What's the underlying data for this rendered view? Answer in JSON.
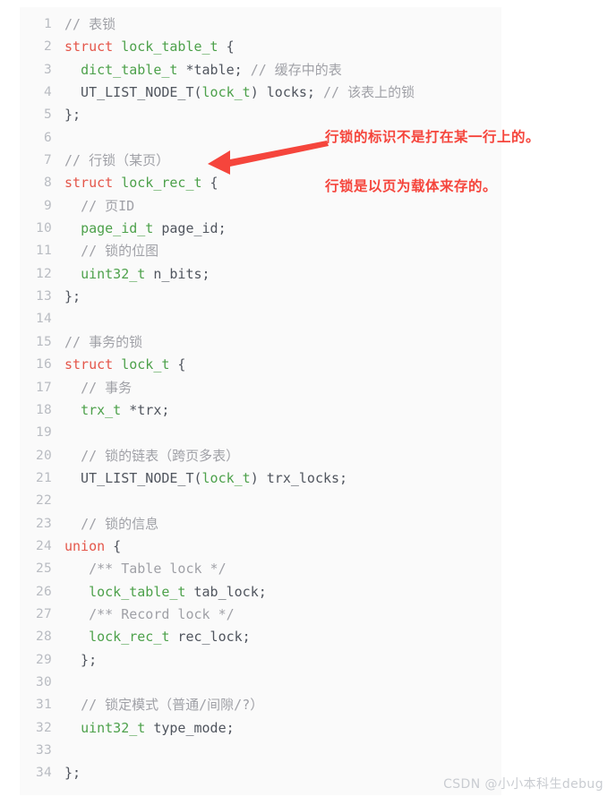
{
  "code_block": {
    "language_style": "c-like",
    "background_color": "#fafafa",
    "gutter_color": "#b9bcc2",
    "token_colors": {
      "comment": "#a0a1a7",
      "keyword": "#e4564a",
      "type": "#4da14b",
      "plain": "#50555e"
    },
    "lines": [
      {
        "n": "1",
        "tokens": [
          {
            "c": "com",
            "t": "// 表锁"
          }
        ]
      },
      {
        "n": "2",
        "tokens": [
          {
            "c": "kw",
            "t": "struct"
          },
          {
            "c": "pln",
            "t": " "
          },
          {
            "c": "typ",
            "t": "lock_table_t"
          },
          {
            "c": "pln",
            "t": " {"
          }
        ]
      },
      {
        "n": "3",
        "tokens": [
          {
            "c": "pln",
            "t": "  "
          },
          {
            "c": "typ",
            "t": "dict_table_t"
          },
          {
            "c": "pln",
            "t": " *table; "
          },
          {
            "c": "com",
            "t": "// 缓存中的表"
          }
        ]
      },
      {
        "n": "4",
        "tokens": [
          {
            "c": "pln",
            "t": "  UT_LIST_NODE_T("
          },
          {
            "c": "typ",
            "t": "lock_t"
          },
          {
            "c": "pln",
            "t": ") locks; "
          },
          {
            "c": "com",
            "t": "// 该表上的锁"
          }
        ]
      },
      {
        "n": "5",
        "tokens": [
          {
            "c": "pln",
            "t": "};"
          }
        ]
      },
      {
        "n": "6",
        "tokens": []
      },
      {
        "n": "7",
        "tokens": [
          {
            "c": "com",
            "t": "// 行锁（某页）"
          }
        ]
      },
      {
        "n": "8",
        "tokens": [
          {
            "c": "kw",
            "t": "struct"
          },
          {
            "c": "pln",
            "t": " "
          },
          {
            "c": "typ",
            "t": "lock_rec_t"
          },
          {
            "c": "pln",
            "t": " {"
          }
        ]
      },
      {
        "n": "9",
        "tokens": [
          {
            "c": "pln",
            "t": "  "
          },
          {
            "c": "com",
            "t": "// 页ID"
          }
        ]
      },
      {
        "n": "10",
        "tokens": [
          {
            "c": "pln",
            "t": "  "
          },
          {
            "c": "typ",
            "t": "page_id_t"
          },
          {
            "c": "pln",
            "t": " page_id;"
          }
        ]
      },
      {
        "n": "11",
        "tokens": [
          {
            "c": "pln",
            "t": "  "
          },
          {
            "c": "com",
            "t": "// 锁的位图"
          }
        ]
      },
      {
        "n": "12",
        "tokens": [
          {
            "c": "pln",
            "t": "  "
          },
          {
            "c": "typ",
            "t": "uint32_t"
          },
          {
            "c": "pln",
            "t": " n_bits;"
          }
        ]
      },
      {
        "n": "13",
        "tokens": [
          {
            "c": "pln",
            "t": "};"
          }
        ]
      },
      {
        "n": "14",
        "tokens": []
      },
      {
        "n": "15",
        "tokens": [
          {
            "c": "com",
            "t": "// 事务的锁"
          }
        ]
      },
      {
        "n": "16",
        "tokens": [
          {
            "c": "kw",
            "t": "struct"
          },
          {
            "c": "pln",
            "t": " "
          },
          {
            "c": "typ",
            "t": "lock_t"
          },
          {
            "c": "pln",
            "t": " {"
          }
        ]
      },
      {
        "n": "17",
        "tokens": [
          {
            "c": "pln",
            "t": "  "
          },
          {
            "c": "com",
            "t": "// 事务"
          }
        ]
      },
      {
        "n": "18",
        "tokens": [
          {
            "c": "pln",
            "t": "  "
          },
          {
            "c": "typ",
            "t": "trx_t"
          },
          {
            "c": "pln",
            "t": " *trx;"
          }
        ]
      },
      {
        "n": "19",
        "tokens": []
      },
      {
        "n": "20",
        "tokens": [
          {
            "c": "pln",
            "t": "  "
          },
          {
            "c": "com",
            "t": "// 锁的链表（跨页多表）"
          }
        ]
      },
      {
        "n": "21",
        "tokens": [
          {
            "c": "pln",
            "t": "  UT_LIST_NODE_T("
          },
          {
            "c": "typ",
            "t": "lock_t"
          },
          {
            "c": "pln",
            "t": ") trx_locks;"
          }
        ]
      },
      {
        "n": "22",
        "tokens": []
      },
      {
        "n": "23",
        "tokens": [
          {
            "c": "pln",
            "t": "  "
          },
          {
            "c": "com",
            "t": "// 锁的信息"
          }
        ]
      },
      {
        "n": "24",
        "tokens": [
          {
            "c": "kw",
            "t": "union"
          },
          {
            "c": "pln",
            "t": " {"
          }
        ]
      },
      {
        "n": "25",
        "tokens": [
          {
            "c": "pln",
            "t": "   "
          },
          {
            "c": "com",
            "t": "/** Table lock */"
          }
        ]
      },
      {
        "n": "26",
        "tokens": [
          {
            "c": "pln",
            "t": "   "
          },
          {
            "c": "typ",
            "t": "lock_table_t"
          },
          {
            "c": "pln",
            "t": " tab_lock;"
          }
        ]
      },
      {
        "n": "27",
        "tokens": [
          {
            "c": "pln",
            "t": "   "
          },
          {
            "c": "com",
            "t": "/** Record lock */"
          }
        ]
      },
      {
        "n": "28",
        "tokens": [
          {
            "c": "pln",
            "t": "   "
          },
          {
            "c": "typ",
            "t": "lock_rec_t"
          },
          {
            "c": "pln",
            "t": " rec_lock;"
          }
        ]
      },
      {
        "n": "29",
        "tokens": [
          {
            "c": "pln",
            "t": "  };"
          }
        ]
      },
      {
        "n": "30",
        "tokens": []
      },
      {
        "n": "31",
        "tokens": [
          {
            "c": "pln",
            "t": "  "
          },
          {
            "c": "com",
            "t": "// 锁定模式（普通/间隙/?）"
          }
        ]
      },
      {
        "n": "32",
        "tokens": [
          {
            "c": "pln",
            "t": "  "
          },
          {
            "c": "typ",
            "t": "uint32_t"
          },
          {
            "c": "pln",
            "t": " type_mode;"
          }
        ]
      },
      {
        "n": "33",
        "tokens": []
      },
      {
        "n": "34",
        "tokens": [
          {
            "c": "pln",
            "t": "};"
          }
        ]
      }
    ]
  },
  "annotations": {
    "color": "#f5453c",
    "line1": "行锁的标识不是打在某一行上的。",
    "line2": "行锁是以页为载体来存的。",
    "arrow_label": "arrow-pointing-to-lock-rec-t"
  },
  "watermark": {
    "text": "CSDN @小小本科生debug",
    "color": "#c9ccd1"
  }
}
